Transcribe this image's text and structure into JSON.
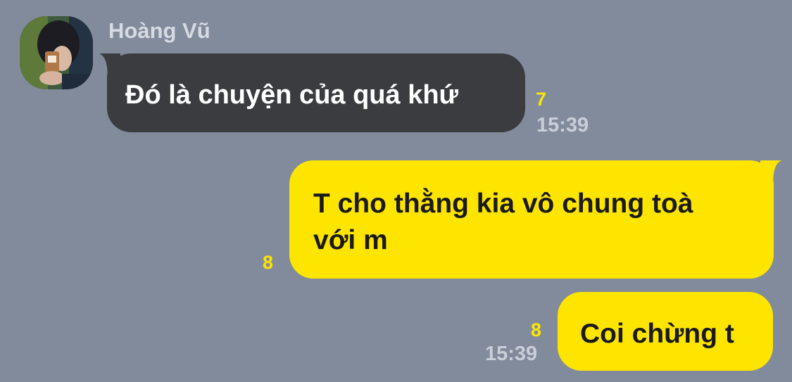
{
  "contact": {
    "name": "Hoàng Vũ"
  },
  "messages": [
    {
      "direction": "incoming",
      "text": "Đó là chuyện của quá khứ",
      "unread": "7",
      "time": "15:39"
    },
    {
      "direction": "outgoing",
      "lines": [
        "T cho thằng kia vô chung toà",
        "với m"
      ],
      "unread": "8"
    },
    {
      "direction": "outgoing",
      "text": "Coi chừng t",
      "unread": "8",
      "time": "15:39"
    }
  ],
  "colors": {
    "background": "#828b9c",
    "incoming_bubble": "#3b3c40",
    "outgoing_bubble": "#fee500",
    "unread_count": "#fee500",
    "timestamp": "#c9ced9",
    "sender_name": "#d6dae3"
  }
}
